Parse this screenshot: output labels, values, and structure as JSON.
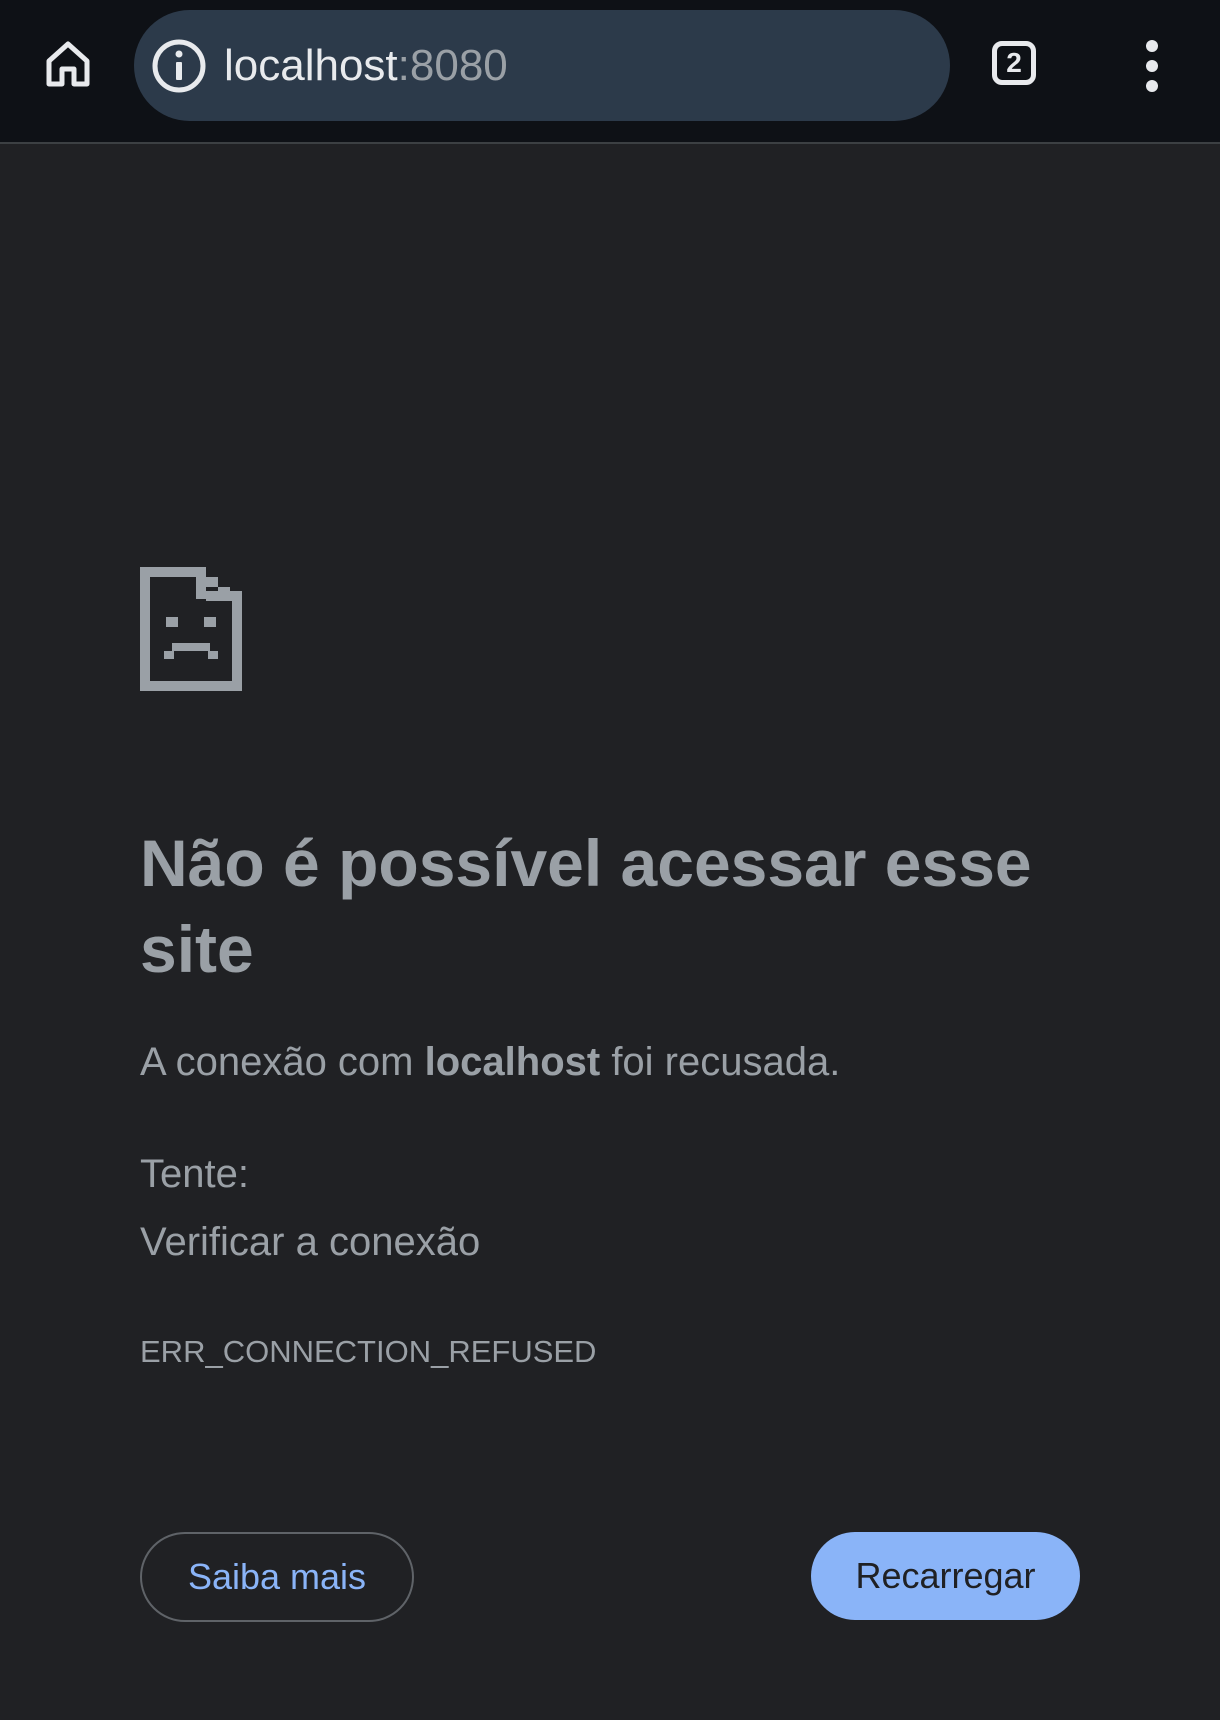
{
  "toolbar": {
    "url_host": "localhost",
    "url_port": ":8080",
    "tab_count": "2",
    "icons": {
      "home": "home-icon",
      "info": "info-icon",
      "tabs": "tab-switcher-icon",
      "menu": "more-vert-icon"
    }
  },
  "error_page": {
    "icon": "sad-page-icon",
    "title": "Não é possível acessar esse site",
    "description_prefix": "A conexão com ",
    "description_host": "localhost",
    "description_suffix": " foi recusada.",
    "try_label": "Tente:",
    "suggestions": [
      "Verificar a conexão"
    ],
    "error_code": "ERR_CONNECTION_REFUSED",
    "buttons": {
      "details": "Saiba mais",
      "reload": "Recarregar"
    }
  },
  "colors": {
    "page_bg": "#202124",
    "toolbar_bg": "#0e1116",
    "omnibox_bg": "#2c3a4a",
    "text_secondary": "#9aa0a6",
    "accent": "#8ab4f8"
  }
}
